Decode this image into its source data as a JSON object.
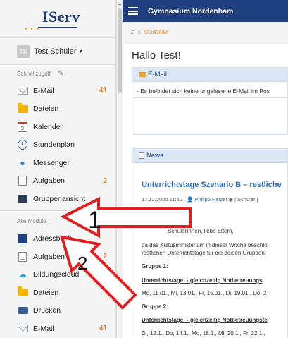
{
  "sidebar": {
    "logo": "IServ",
    "user": {
      "initials": "TS",
      "name": "Test Schüler"
    },
    "quick_access_title": "Schnellzugriff",
    "quick_items": [
      {
        "label": "E-Mail",
        "icon": "mail-icon",
        "count": "41"
      },
      {
        "label": "Dateien",
        "icon": "folder-icon",
        "count": ""
      },
      {
        "label": "Kalender",
        "icon": "calendar-icon",
        "count": "",
        "icon_text": "9"
      },
      {
        "label": "Stundenplan",
        "icon": "clock-icon",
        "count": ""
      },
      {
        "label": "Messenger",
        "icon": "messenger-icon",
        "count": ""
      },
      {
        "label": "Aufgaben",
        "icon": "task-icon",
        "count": "2"
      },
      {
        "label": "Gruppenansicht",
        "icon": "group-icon",
        "count": ""
      }
    ],
    "all_modules_title": "Alle Module",
    "module_items": [
      {
        "label": "Adressbuch",
        "icon": "addressbook-icon",
        "count": ""
      },
      {
        "label": "Aufgaben",
        "icon": "task-icon",
        "count": "2"
      },
      {
        "label": "Bildungscloud",
        "icon": "cloud-icon",
        "count": ""
      },
      {
        "label": "Dateien",
        "icon": "folder-icon",
        "count": ""
      },
      {
        "label": "Drucken",
        "icon": "printer-icon",
        "count": ""
      },
      {
        "label": "E-Mail",
        "icon": "mail-icon",
        "count": "41"
      }
    ]
  },
  "header": {
    "school": "Gymnasium Nordenham"
  },
  "breadcrumb": {
    "current": "Startseite"
  },
  "main": {
    "title": "Hallo Test!",
    "mail_panel": {
      "title": "E-Mail",
      "text": "- Es befindet sich keine ungelesene E-Mail im Pos"
    },
    "news_panel": {
      "title": "News",
      "article_title": "Unterrichtstage Szenario B – restliche",
      "meta_date": "17.12.2020 11:50 |",
      "meta_author": "Philipp Hetzel",
      "meta_rest": "| Schüler |",
      "greeting": "SchülerInnen, liebe Eltern,",
      "para1": "da das Kultusministerium in dieser Woche beschlo",
      "para2": "restlichen Unterrichtstage für die beiden Gruppen:",
      "group1": "Gruppe 1:",
      "ut1": "Unterrichtstage:    - gleichzeitig Notbetreuungs",
      "dates1": "Mo, 11.01., Mi, 13.01., Fr, 15.01., Di, 19.01., Do, 2",
      "group2": "Gruppe 2:",
      "ut2": "Unterrichtstage: - gleichzeitig Notbetreuungste",
      "dates2": "Di, 12.1., Do, 14.1., Mo, 18.1., Mi, 20.1., Fr, 22.1.,"
    }
  },
  "annotations": [
    {
      "label": "1",
      "color": "#e02020"
    },
    {
      "label": "2",
      "color": "#e02020"
    }
  ]
}
